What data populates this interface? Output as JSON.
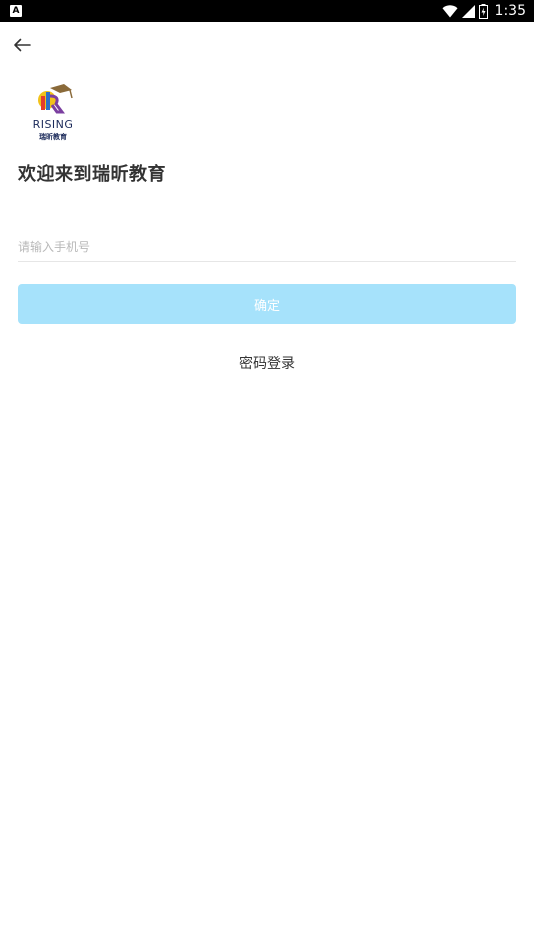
{
  "status_bar": {
    "time": "1:35",
    "app_icon_letter": "A",
    "icons": [
      "wifi-icon",
      "signal-icon",
      "battery-icon"
    ]
  },
  "header": {
    "back_icon": "arrow-left-icon"
  },
  "logo": {
    "brand": "RISING",
    "subtitle": "瑞昕教育"
  },
  "welcome_title": "欢迎来到瑞昕教育",
  "phone_field": {
    "placeholder": "请输入手机号",
    "value": ""
  },
  "confirm_button": {
    "label": "确定",
    "color": "#a6e2fb"
  },
  "password_login_link": "密码登录"
}
